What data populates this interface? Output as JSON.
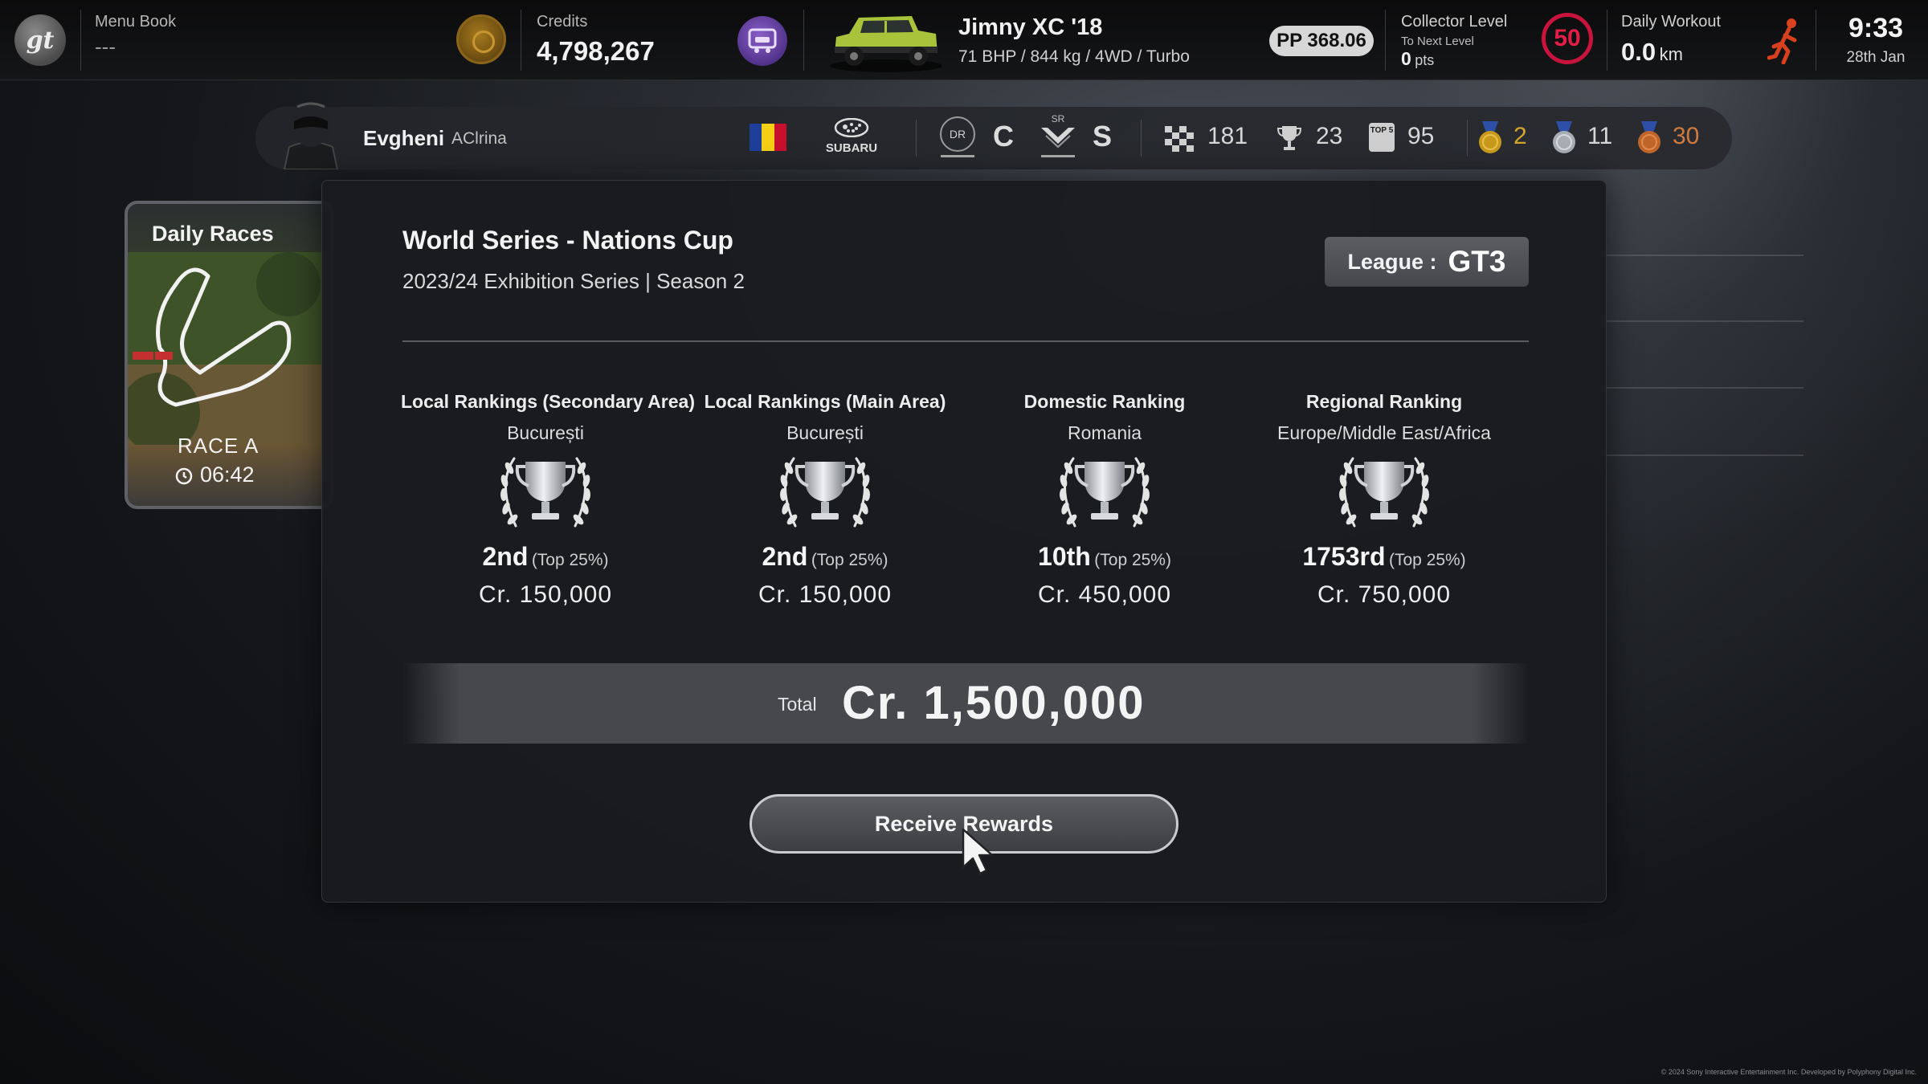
{
  "topbar": {
    "menu_book_label": "Menu Book",
    "menu_book_value": "---",
    "credits_label": "Credits",
    "credits_value": "4,798,267",
    "car_name": "Jimny XC '18",
    "car_specs": "71 BHP / 844 kg / 4WD / Turbo",
    "pp_value": "PP 368.06",
    "collector_label": "Collector Level",
    "collector_next_label": "To Next Level",
    "collector_pts_value": "0",
    "collector_pts_unit": "pts",
    "collector_level": "50",
    "workout_label": "Daily Workout",
    "workout_value": "0.0",
    "workout_unit": "km",
    "time": "9:33",
    "date": "28th Jan"
  },
  "profile": {
    "name": "Evgheni",
    "id": "AClrina",
    "manufacturer": "SUBARU",
    "driver_rating_label": "DR",
    "driver_rating": "C",
    "sportsmanship_label": "SR",
    "sportsmanship_rating": "S",
    "races": "181",
    "wins": "23",
    "top5_label": "TOP 5",
    "top5": "95",
    "gold_medals": "2",
    "silver_medals": "11",
    "bronze_medals": "30"
  },
  "daily_races": {
    "title": "Daily Races",
    "race_label": "RACE A",
    "timer": "06:42"
  },
  "event": {
    "title": "World Series - Nations Cup",
    "subtitle": "2023/24 Exhibition Series | Season 2",
    "league_label": "League :",
    "league_value": "GT3"
  },
  "rankings": [
    {
      "title": "Local Rankings (Secondary Area)",
      "area": "București",
      "position": "2nd",
      "percent": "(Top 25%)",
      "reward": "Cr.   150,000"
    },
    {
      "title": "Local Rankings (Main Area)",
      "area": "București",
      "position": "2nd",
      "percent": "(Top 25%)",
      "reward": "Cr.   150,000"
    },
    {
      "title": "Domestic Ranking",
      "area": "Romania",
      "position": "10th",
      "percent": "(Top 25%)",
      "reward": "Cr.   450,000"
    },
    {
      "title": "Regional Ranking",
      "area": "Europe/Middle East/Africa",
      "position": "1753rd",
      "percent": "(Top 25%)",
      "reward": "Cr.   750,000"
    }
  ],
  "total": {
    "label": "Total",
    "value": "Cr.   1,500,000"
  },
  "receive_button_label": "Receive Rewards",
  "copyright": "© 2024 Sony Interactive Entertainment Inc. Developed by Polyphony Digital Inc.",
  "colors": {
    "collector_ring": "#c8143c",
    "gold": "#c79a1c",
    "silver": "#a8adb4",
    "bronze": "#c0652a",
    "credits_coin": "#8a6418",
    "garage_icon": "#6a44a8",
    "runner": "#d8401e"
  }
}
